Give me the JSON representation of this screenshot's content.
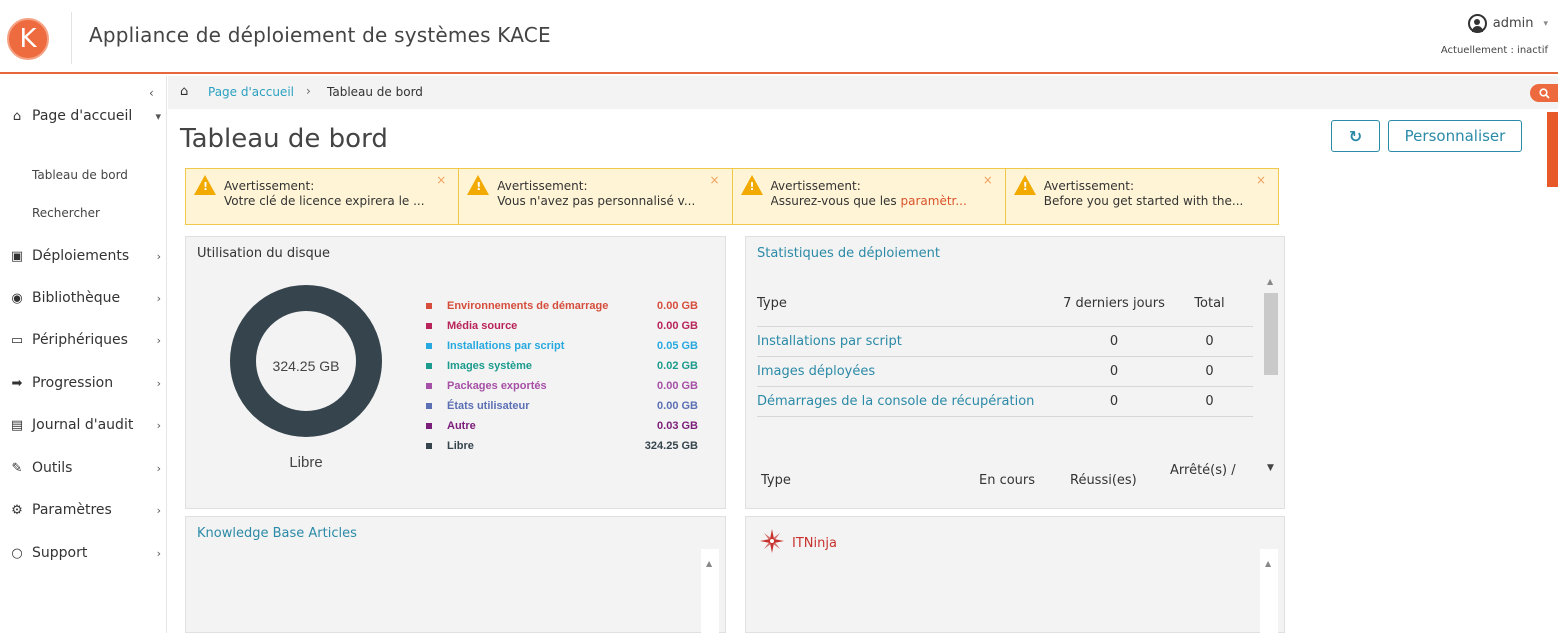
{
  "header": {
    "logo_glyph": "K",
    "app_title": "Appliance de déploiement de systèmes KACE",
    "user_name": "admin",
    "user_caret": "▾",
    "status": "Actuellement : inactif"
  },
  "sidebar": {
    "collapse_glyph": "‹",
    "items": [
      {
        "label": "Page d'accueil",
        "icon": "home-icon",
        "glyph": "⌂",
        "chev": "▾"
      },
      {
        "label": "Déploiements",
        "icon": "deploy-icon",
        "glyph": "▣",
        "chev": "›"
      },
      {
        "label": "Bibliothèque",
        "icon": "library-icon",
        "glyph": "◉",
        "chev": "›"
      },
      {
        "label": "Périphériques",
        "icon": "monitor-icon",
        "glyph": "▭",
        "chev": "›"
      },
      {
        "label": "Progression",
        "icon": "progress-icon",
        "glyph": "➡",
        "chev": "›"
      },
      {
        "label": "Journal d'audit",
        "icon": "journal-icon",
        "glyph": "▤",
        "chev": "›"
      },
      {
        "label": "Outils",
        "icon": "wrench-icon",
        "glyph": "✎",
        "chev": "›"
      },
      {
        "label": "Paramètres",
        "icon": "gear-icon",
        "glyph": "⚙",
        "chev": "›"
      },
      {
        "label": "Support",
        "icon": "support-icon",
        "glyph": "○",
        "chev": "›"
      }
    ],
    "sub_items": [
      "Tableau de bord",
      "Rechercher"
    ]
  },
  "breadcrumb": {
    "home_glyph": "⌂",
    "link": "Page d'accueil",
    "separator": "›",
    "current": "Tableau de bord"
  },
  "page": {
    "title": "Tableau de bord",
    "refresh_glyph": "↻",
    "customize_label": "Personnaliser"
  },
  "alerts": [
    {
      "title": "Avertissement:",
      "text_pre": "Votre clé de licence expirera le ...",
      "text_accent": "",
      "text_post": ""
    },
    {
      "title": "Avertissement:",
      "text_pre": "Vous n'avez pas personnalisé v...",
      "text_accent": "",
      "text_post": ""
    },
    {
      "title": "Avertissement:",
      "text_pre": "Assurez-vous que les ",
      "text_accent": "paramètr...",
      "text_post": ""
    },
    {
      "title": "Avertissement:",
      "text_pre": "Before you get started with the...",
      "text_accent": "",
      "text_post": ""
    }
  ],
  "alert_close": "×",
  "disk": {
    "title": "Utilisation du disque",
    "center_value": "324.25 GB",
    "label": "Libre",
    "legend": [
      {
        "name": "Environnements de démarrage",
        "value": "0.00 GB",
        "color": "#d64d3b"
      },
      {
        "name": "Média source",
        "value": "0.00 GB",
        "color": "#b82359"
      },
      {
        "name": "Installations par script",
        "value": "0.05 GB",
        "color": "#27a9e0"
      },
      {
        "name": "Images système",
        "value": "0.02 GB",
        "color": "#1b9b8d"
      },
      {
        "name": "Packages exportés",
        "value": "0.00 GB",
        "color": "#a64fa6"
      },
      {
        "name": "États utilisateur",
        "value": "0.00 GB",
        "color": "#5b6fb4"
      },
      {
        "name": "Autre",
        "value": "0.03 GB",
        "color": "#7b1e7a"
      },
      {
        "name": "Libre",
        "value": "324.25 GB",
        "color": "#36444d"
      }
    ]
  },
  "chart_data": {
    "type": "pie",
    "categories": [
      "Environnements de démarrage",
      "Média source",
      "Installations par script",
      "Images système",
      "Packages exportés",
      "États utilisateur",
      "Autre",
      "Libre"
    ],
    "values": [
      0.0,
      0.0,
      0.05,
      0.02,
      0.0,
      0.0,
      0.03,
      324.25
    ],
    "title": "Utilisation du disque"
  },
  "stats": {
    "title": "Statistiques de déploiement",
    "headers": [
      "Type",
      "7 derniers jours",
      "Total"
    ],
    "rows": [
      {
        "type": "Installations par script",
        "last7": "0",
        "total": "0"
      },
      {
        "type": "Images déployées",
        "last7": "0",
        "total": "0"
      },
      {
        "type": "Démarrages de la console de récupération",
        "last7": "0",
        "total": "0"
      }
    ],
    "headers2": [
      "Type",
      "En cours",
      "Réussi(es)",
      "Arrêté(s) /"
    ]
  },
  "kb": {
    "title": "Knowledge Base Articles"
  },
  "itninja": {
    "title": "ITNinja"
  },
  "colors": {
    "accent": "#e8673c",
    "link": "#2b8aa7",
    "panel": "#f3f3f3"
  }
}
